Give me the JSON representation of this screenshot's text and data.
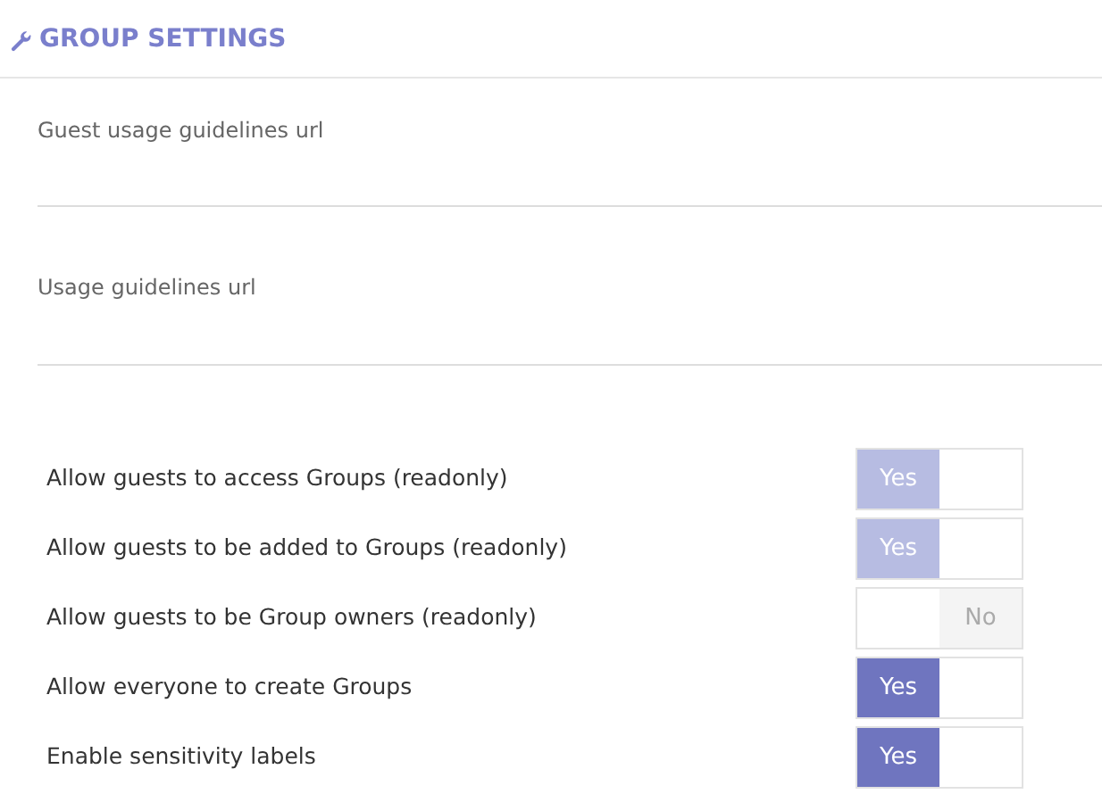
{
  "section": {
    "title": "GROUP SETTINGS"
  },
  "fields": [
    {
      "label": "Guest usage guidelines url"
    },
    {
      "label": "Usage guidelines url"
    }
  ],
  "toggles": [
    {
      "label": "Allow guests to access Groups (readonly)",
      "on": true,
      "disabled": true,
      "on_text": "Yes"
    },
    {
      "label": "Allow guests to be added to Groups (readonly)",
      "on": true,
      "disabled": true,
      "on_text": "Yes"
    },
    {
      "label": "Allow guests to be Group owners (readonly)",
      "on": false,
      "disabled": true,
      "off_text": "No"
    },
    {
      "label": "Allow everyone to create Groups",
      "on": true,
      "disabled": false,
      "on_text": "Yes"
    },
    {
      "label": "Enable sensitivity labels",
      "on": true,
      "disabled": false,
      "on_text": "Yes"
    }
  ]
}
